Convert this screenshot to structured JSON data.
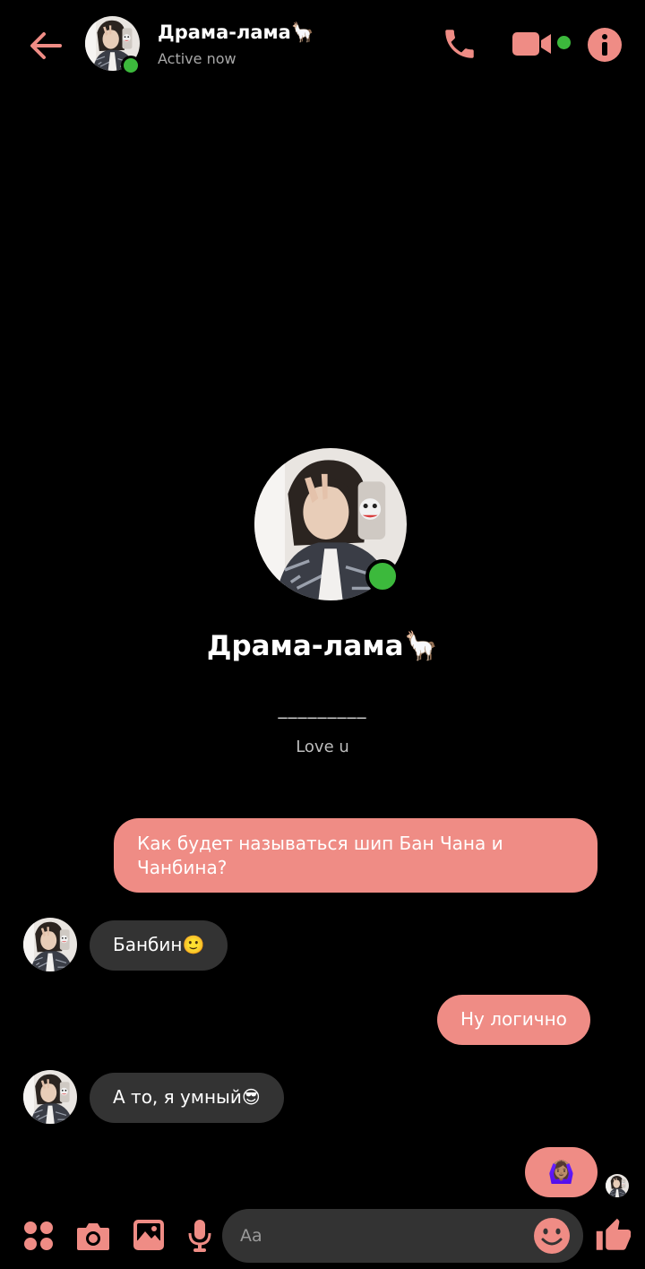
{
  "theme": {
    "accent": "#ef8c85",
    "online": "#3cb93c",
    "background": "#000000",
    "incoming_bubble": "#333333"
  },
  "header": {
    "name": "Драма-лама🦙",
    "status": "Active now",
    "icons": [
      "back-arrow-icon",
      "phone-icon",
      "video-camera-icon",
      "info-icon"
    ]
  },
  "profile": {
    "name": "Драма-лама🦙",
    "divider": "_________",
    "bio": "Love u"
  },
  "messages": [
    {
      "direction": "outgoing",
      "text": "Как будет называться шип Бан Чана и Чанбина?"
    },
    {
      "direction": "incoming",
      "text": "Банбин🙂"
    },
    {
      "direction": "outgoing",
      "text": "Ну логично"
    },
    {
      "direction": "incoming",
      "text": "А то, я умный😎"
    },
    {
      "direction": "outgoing",
      "text": "🙆🏽‍♀️"
    }
  ],
  "composer": {
    "placeholder": "Aa",
    "icons": [
      "menu-icon",
      "camera-icon",
      "gallery-icon",
      "microphone-icon",
      "emoji-icon",
      "thumbs-up-icon"
    ]
  }
}
